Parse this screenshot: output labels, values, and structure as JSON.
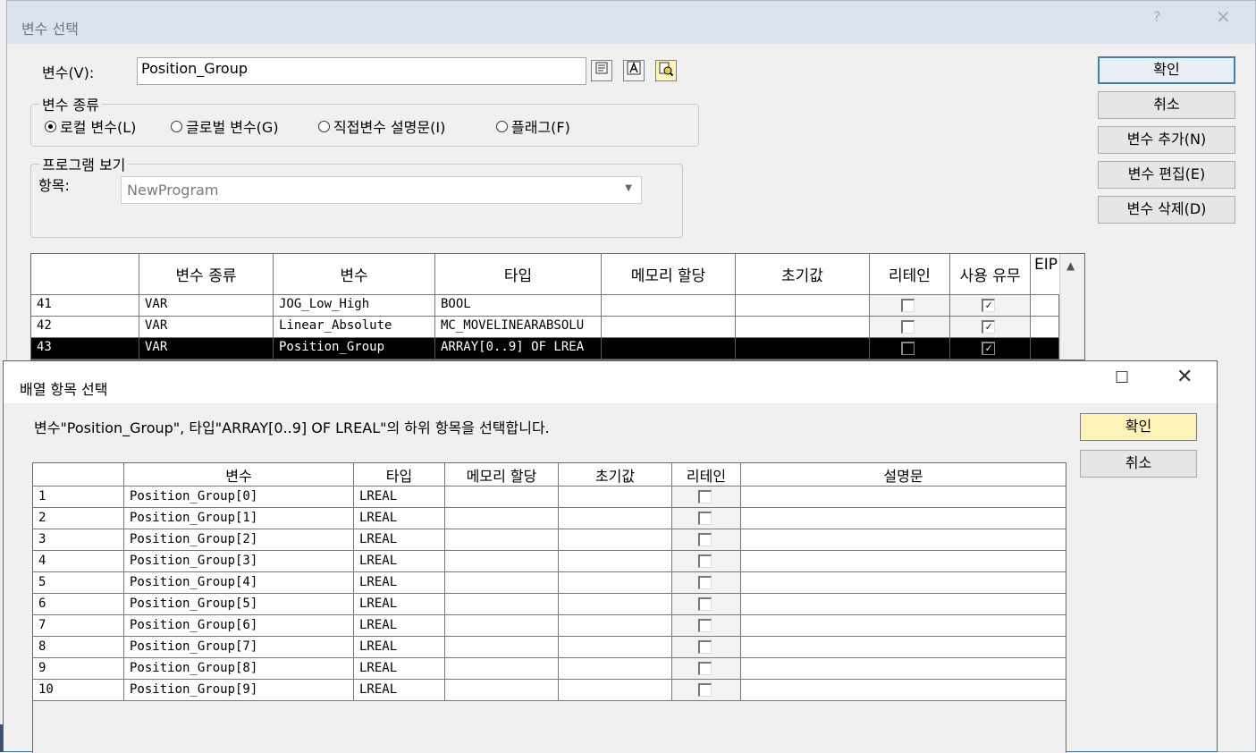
{
  "var_select_dialog": {
    "title": "변수 선택",
    "help_glyph": "?",
    "close_glyph": "✕",
    "variable_label": "변수(V):",
    "variable_value": "Position_Group",
    "toolbar_icons": [
      "variable-list-icon",
      "text-a-icon",
      "search-document-icon"
    ],
    "var_kind_group": {
      "legend": "변수 종류",
      "options": [
        "로컬 변수(L)",
        "글로벌 변수(G)",
        "직접변수 설명문(I)",
        "플래그(F)"
      ],
      "selected": "로컬 변수(L)"
    },
    "program_group": {
      "legend": "프로그램 보기",
      "item_label": "항목:",
      "selected_program": "NewProgram"
    },
    "buttons": {
      "ok": "확인",
      "cancel": "취소",
      "add": "변수 추가(N)",
      "edit": "변수 편집(E)",
      "delete": "변수 삭제(D)"
    },
    "grid": {
      "columns": [
        "",
        "변수 종류",
        "변수",
        "타입",
        "메모리 할당",
        "초기값",
        "리테인",
        "사용 유무",
        "EIP"
      ],
      "rows": [
        {
          "num": "41",
          "kind": "VAR",
          "name": "JOG_Low_High",
          "type": "BOOL",
          "memory": "",
          "init": "",
          "retain": false,
          "used": true,
          "selected": false
        },
        {
          "num": "42",
          "kind": "VAR",
          "name": "Linear_Absolute",
          "type": "MC_MOVELINEARABSOLU",
          "memory": "",
          "init": "",
          "retain": false,
          "used": true,
          "selected": false
        },
        {
          "num": "43",
          "kind": "VAR",
          "name": "Position_Group",
          "type": "ARRAY[0..9] OF LREA",
          "memory": "",
          "init": "",
          "retain": false,
          "used": true,
          "selected": true
        }
      ]
    }
  },
  "array_item_dialog": {
    "title": "배열 항목 선택",
    "max_glyph": "☐",
    "close_glyph": "✕",
    "description": "변수\"Position_Group\", 타입\"ARRAY[0..9] OF LREAL\"의 하위 항목을 선택합니다.",
    "buttons": {
      "ok": "확인",
      "cancel": "취소"
    },
    "grid": {
      "columns": [
        "",
        "변수",
        "타입",
        "메모리 할당",
        "초기값",
        "리테인",
        "설명문"
      ],
      "rows": [
        {
          "num": "1",
          "name": "Position_Group[0]",
          "type": "LREAL",
          "memory": "",
          "init": "",
          "retain": false,
          "comment": ""
        },
        {
          "num": "2",
          "name": "Position_Group[1]",
          "type": "LREAL",
          "memory": "",
          "init": "",
          "retain": false,
          "comment": ""
        },
        {
          "num": "3",
          "name": "Position_Group[2]",
          "type": "LREAL",
          "memory": "",
          "init": "",
          "retain": false,
          "comment": ""
        },
        {
          "num": "4",
          "name": "Position_Group[3]",
          "type": "LREAL",
          "memory": "",
          "init": "",
          "retain": false,
          "comment": ""
        },
        {
          "num": "5",
          "name": "Position_Group[4]",
          "type": "LREAL",
          "memory": "",
          "init": "",
          "retain": false,
          "comment": ""
        },
        {
          "num": "6",
          "name": "Position_Group[5]",
          "type": "LREAL",
          "memory": "",
          "init": "",
          "retain": false,
          "comment": ""
        },
        {
          "num": "7",
          "name": "Position_Group[6]",
          "type": "LREAL",
          "memory": "",
          "init": "",
          "retain": false,
          "comment": ""
        },
        {
          "num": "8",
          "name": "Position_Group[7]",
          "type": "LREAL",
          "memory": "",
          "init": "",
          "retain": false,
          "comment": ""
        },
        {
          "num": "9",
          "name": "Position_Group[8]",
          "type": "LREAL",
          "memory": "",
          "init": "",
          "retain": false,
          "comment": ""
        },
        {
          "num": "10",
          "name": "Position_Group[9]",
          "type": "LREAL",
          "memory": "",
          "init": "",
          "retain": false,
          "comment": ""
        }
      ]
    }
  },
  "colors": {
    "selected_row_bg": "#000000",
    "default_button_border": "#3c7fb1",
    "ok_button_highlight": "#fff3b8",
    "active_dialog_border": "#2e6fb7"
  }
}
